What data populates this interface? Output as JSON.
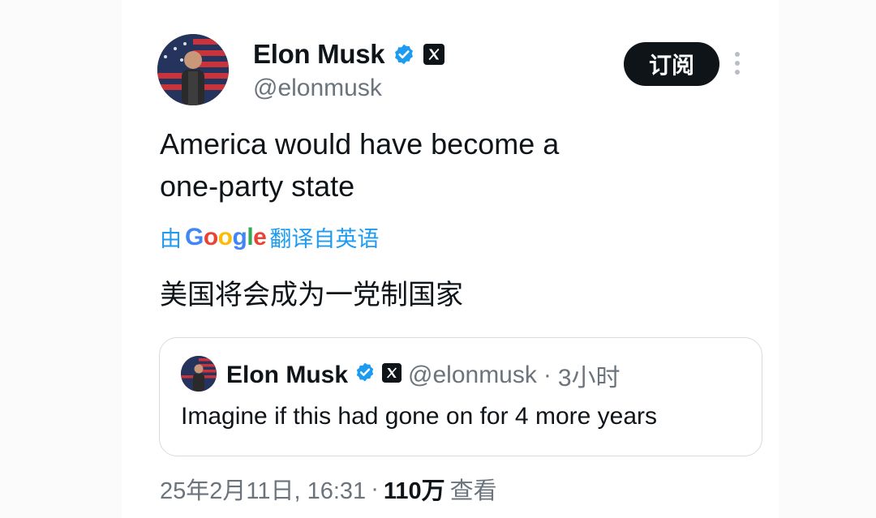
{
  "tweet": {
    "author": {
      "name": "Elon Musk",
      "handle": "@elonmusk"
    },
    "subscribe_label": "订阅",
    "text_line1": "America would have become a",
    "text_line2": "one-party state",
    "translate": {
      "prefix": "由",
      "brand": "Google",
      "suffix": "翻译自英语"
    },
    "translated_text": "美国将会成为一党制国家",
    "quote": {
      "name": "Elon Musk",
      "handle": "@elonmusk",
      "separator": "·",
      "time": "3小时",
      "text": "Imagine if this had gone on for 4 more years"
    },
    "footer": {
      "datetime": "25年2月11日, 16:31",
      "separator": "·",
      "views": "110万",
      "views_label": "查看"
    }
  },
  "colors": {
    "verified": "#1d9bf0",
    "translate_link": "#1d9bf0",
    "button_bg": "#0f1419"
  }
}
